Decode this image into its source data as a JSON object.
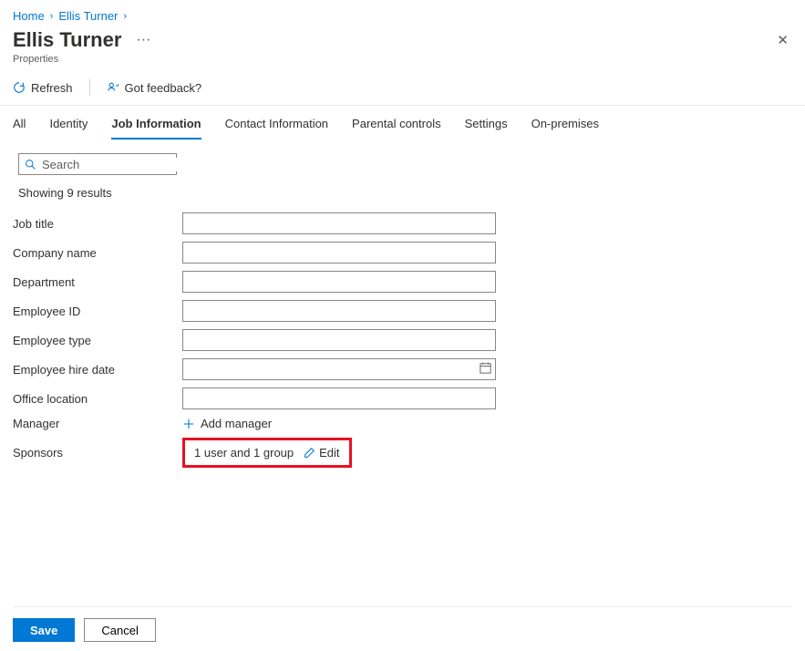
{
  "breadcrumb": {
    "home": "Home",
    "user": "Ellis Turner"
  },
  "header": {
    "title": "Ellis Turner",
    "subtitle": "Properties"
  },
  "toolbar": {
    "refresh": "Refresh",
    "feedback": "Got feedback?"
  },
  "tabs": {
    "all": "All",
    "identity": "Identity",
    "job": "Job Information",
    "contact": "Contact Information",
    "parental": "Parental controls",
    "settings": "Settings",
    "onprem": "On-premises"
  },
  "search": {
    "placeholder": "Search"
  },
  "results": {
    "text": "Showing 9 results"
  },
  "fields": {
    "job_title": {
      "label": "Job title",
      "value": ""
    },
    "company_name": {
      "label": "Company name",
      "value": ""
    },
    "department": {
      "label": "Department",
      "value": ""
    },
    "employee_id": {
      "label": "Employee ID",
      "value": ""
    },
    "employee_type": {
      "label": "Employee type",
      "value": ""
    },
    "hire_date": {
      "label": "Employee hire date",
      "value": ""
    },
    "office_location": {
      "label": "Office location",
      "value": ""
    },
    "manager": {
      "label": "Manager",
      "action": "Add manager"
    },
    "sponsors": {
      "label": "Sponsors",
      "value": "1 user and 1 group",
      "edit": "Edit"
    }
  },
  "footer": {
    "save": "Save",
    "cancel": "Cancel"
  }
}
